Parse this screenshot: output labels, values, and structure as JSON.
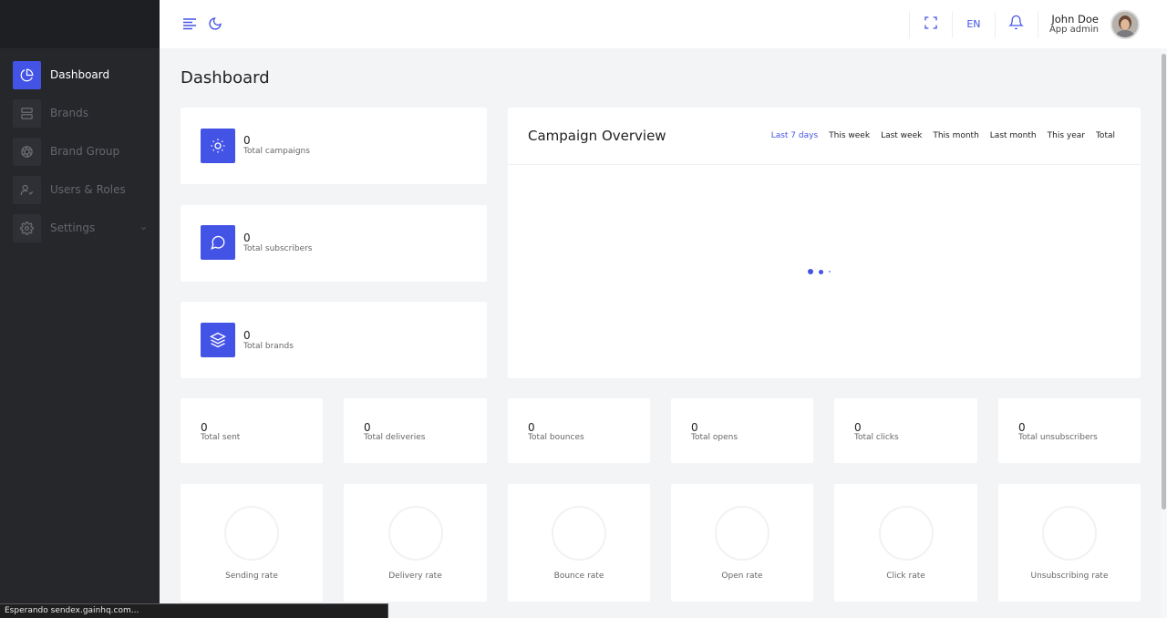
{
  "colors": {
    "accent": "#4353e6",
    "sidebar_bg": "#26272b",
    "page_bg": "#f3f4f6"
  },
  "sidebar": {
    "items": [
      {
        "label": "Dashboard",
        "icon": "pie-chart-icon",
        "active": true
      },
      {
        "label": "Brands",
        "icon": "server-icon",
        "active": false
      },
      {
        "label": "Brand Group",
        "icon": "aperture-icon",
        "active": false
      },
      {
        "label": "Users & Roles",
        "icon": "user-check-icon",
        "active": false
      },
      {
        "label": "Settings",
        "icon": "gear-icon",
        "active": false,
        "has_submenu": true
      }
    ]
  },
  "header": {
    "icons": [
      "menu-icon",
      "moon-icon",
      "fullscreen-icon",
      "bell-icon"
    ],
    "language": "EN",
    "user": {
      "name": "John Doe",
      "role": "App admin"
    }
  },
  "main": {
    "page_title": "Dashboard",
    "stat_cards": [
      {
        "value": "0",
        "label": "Total campaigns",
        "icon": "sun-icon"
      },
      {
        "value": "0",
        "label": "Total subscribers",
        "icon": "message-circle-icon"
      },
      {
        "value": "0",
        "label": "Total brands",
        "icon": "layers-icon"
      }
    ],
    "campaign_overview": {
      "title": "Campaign Overview",
      "filters": [
        "Last 7 days",
        "This week",
        "Last week",
        "This month",
        "Last month",
        "This year",
        "Total"
      ],
      "selected_filter": "Last 7 days"
    },
    "totals": [
      {
        "value": "0",
        "label": "Total sent"
      },
      {
        "value": "0",
        "label": "Total deliveries"
      },
      {
        "value": "0",
        "label": "Total bounces"
      },
      {
        "value": "0",
        "label": "Total opens"
      },
      {
        "value": "0",
        "label": "Total clicks"
      },
      {
        "value": "0",
        "label": "Total unsubscribers"
      }
    ],
    "rates": [
      {
        "label": "Sending rate"
      },
      {
        "label": "Delivery rate"
      },
      {
        "label": "Bounce rate"
      },
      {
        "label": "Open rate"
      },
      {
        "label": "Click rate"
      },
      {
        "label": "Unsubscribing rate"
      }
    ]
  },
  "status_bar": {
    "text": "Esperando sendex.gainhq.com..."
  }
}
